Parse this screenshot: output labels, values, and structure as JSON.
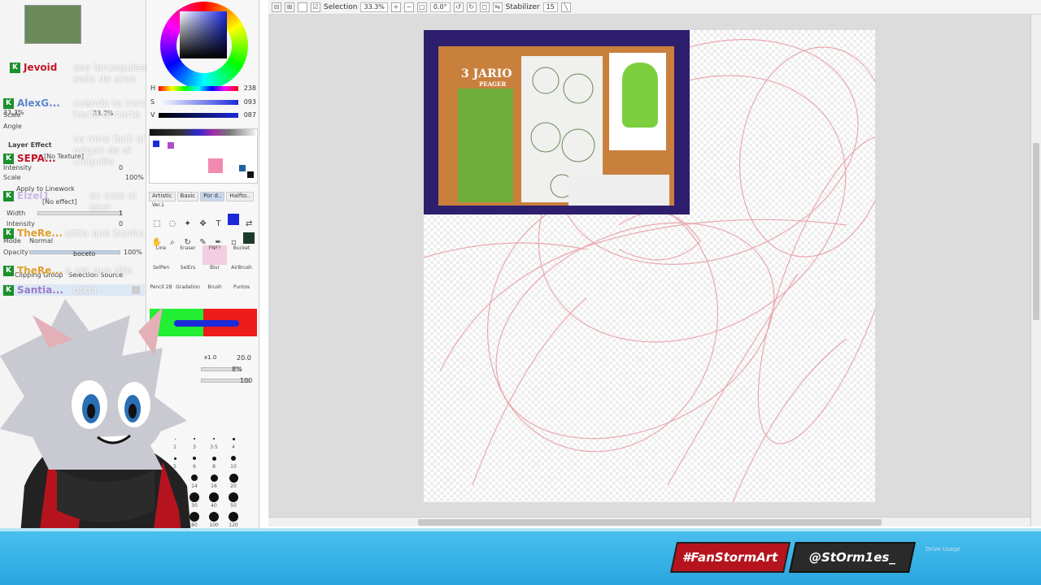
{
  "toolbar": {
    "selection_label": "Selection",
    "zoom": "33.3%",
    "angle": "0.0°",
    "stabilizer_label": "Stabilizer",
    "stabilizer_value": "15"
  },
  "navigator": {
    "zoom": "33.3%",
    "scale_label": "Scale",
    "angle_label": "Angle"
  },
  "layer_effect": {
    "title": "Layer Effect",
    "texture_label": "Texture",
    "texture_value": "[No Texture]",
    "intensity_label": "Intensity",
    "intensity_value": "0",
    "scale_label": "Scale",
    "scale_value": "100%",
    "apply_to_linework": "Apply to Linework",
    "effect_label": "Effect",
    "effect_value": "[No effect]",
    "width_label": "Width",
    "width_value": "1",
    "intensity2_label": "Intensity",
    "intensity2_value": "0"
  },
  "layer": {
    "mode_label": "Mode",
    "mode_value": "Normal",
    "opacity_label": "Opacity",
    "opacity_value": "100%",
    "clipping_group": "Clipping Group",
    "selection_source": "Selection Source",
    "layer_name": "boceto"
  },
  "chat": [
    {
      "user": "Jevoid",
      "color": "#c0182a",
      "message": "ese lanzaguisantes salio de area"
    },
    {
      "user": "AlexG...",
      "color": "#5d86c9",
      "message": "cuando te miro hacia el norte"
    },
    {
      "user": "SEPA...",
      "color": "#c0182a",
      "message": "se mira facil el origen de el chiquillo"
    },
    {
      "user": "Elzel1",
      "color": "#c9b8e6",
      "message": "es este el bien"
    },
    {
      "user": "TheRe...",
      "color": "#e0a030",
      "message": "ostia que bonito"
    },
    {
      "user": "TheRe...",
      "color": "#e0a030",
      "message": "a ver que dije"
    },
    {
      "user": "Santia...",
      "color": "#9c7ac9",
      "message": "ostia"
    }
  ],
  "color_panel": {
    "h_value": "238",
    "s_value": "093",
    "v_value": "087",
    "h_label": "H",
    "s_label": "S",
    "v_label": "V"
  },
  "brush_tabs": [
    "Artistic",
    "Basic",
    "Por d..",
    "Halfto.."
  ],
  "ver_label": "Ver.1",
  "brushes": [
    {
      "label": "Line"
    },
    {
      "label": "Eraser"
    },
    {
      "label": "FNF?"
    },
    {
      "label": "Bucket"
    },
    {
      "label": "SelPen"
    },
    {
      "label": "SelErs"
    },
    {
      "label": "Blur"
    },
    {
      "label": "AirBrush"
    },
    {
      "label": "Pencil 2B"
    },
    {
      "label": "Gradation"
    },
    {
      "label": "Brush"
    },
    {
      "label": "Puntos"
    }
  ],
  "brush_settings": {
    "size_multiplier": "x1.0",
    "size": "20.0",
    "min_size": "8%",
    "density": "100"
  },
  "size_labels": [
    "1",
    "3",
    "3.5",
    "4",
    "5",
    "6",
    "8",
    "10",
    "12",
    "14",
    "16",
    "20",
    "25",
    "30",
    "40",
    "50",
    "60",
    "80",
    "100",
    "120"
  ],
  "canvas": {
    "ref_title": "JARIO",
    "ref_subtitle": "PEAGER",
    "ref_number": "3"
  },
  "social": {
    "handle1": "#FanStormArt",
    "handle2": "@StOrm1es_",
    "drive_usage": "Drive Usage"
  },
  "colors": {
    "accent_red": "#b5141e",
    "banner_blue": "#2aa5e0",
    "sketch_pink": "#e8a0a8"
  }
}
